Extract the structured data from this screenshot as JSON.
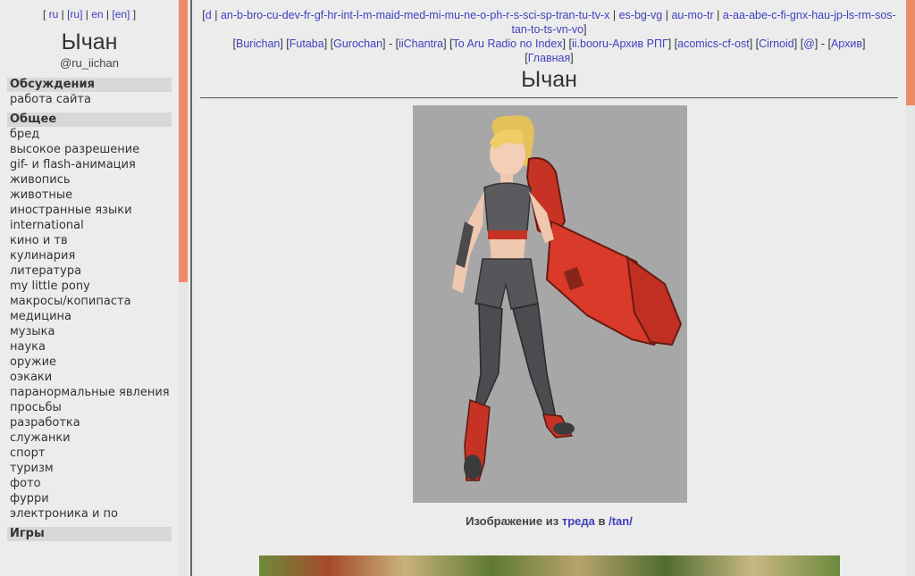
{
  "sidebar": {
    "lang_links": [
      {
        "label": "ru",
        "prefix": "[ ",
        "suffix": " | "
      },
      {
        "label": "[ru]",
        "prefix": "",
        "suffix": " | "
      },
      {
        "label": "en",
        "prefix": "",
        "suffix": " | "
      },
      {
        "label": "[en]",
        "prefix": "",
        "suffix": " ]"
      }
    ],
    "title": "Ычан",
    "handle": "@ru_iichan",
    "sections": [
      {
        "header": "Обсуждения",
        "items": [
          "работа сайта"
        ]
      },
      {
        "header": "Общее",
        "items": [
          "бред",
          "высокое разрешение",
          "gif- и flash-анимация",
          "живопись",
          "животные",
          "иностранные языки",
          "international",
          "кино и тв",
          "кулинария",
          "литература",
          "my little pony",
          "макросы/копипаста",
          "медицина",
          "музыка",
          "наука",
          "оружие",
          "оэкаки",
          "паранормальные явления",
          "просьбы",
          "разработка",
          "служанки",
          "спорт",
          "туризм",
          "фото",
          "фурри",
          "электроника и по"
        ]
      },
      {
        "header": "Игры",
        "items": []
      }
    ]
  },
  "nav": {
    "lines": [
      [
        {
          "t": "[",
          "link": false
        },
        {
          "t": "d",
          "link": true
        },
        {
          "t": " | ",
          "link": false
        },
        {
          "t": "an-b-bro-cu-dev-fr-gf-hr-int-l-m-maid-med-mi-mu-ne-o-ph-r-s-sci-sp-tran-tu-tv-x",
          "link": true
        },
        {
          "t": " | ",
          "link": false
        },
        {
          "t": "es-bg-vg",
          "link": true
        },
        {
          "t": " | ",
          "link": false
        },
        {
          "t": "au-mo-tr",
          "link": true
        },
        {
          "t": " | ",
          "link": false
        },
        {
          "t": "a-aa-abe-c-fi-gnx-hau-jp-ls-rm-sos-tan-to-ts-vn-vo",
          "link": true
        },
        {
          "t": "]",
          "link": false
        }
      ],
      [
        {
          "t": "[",
          "link": false
        },
        {
          "t": "Burichan",
          "link": true
        },
        {
          "t": "] [",
          "link": false
        },
        {
          "t": "Futaba",
          "link": true
        },
        {
          "t": "] [",
          "link": false
        },
        {
          "t": "Gurochan",
          "link": true
        },
        {
          "t": "] - [",
          "link": false
        },
        {
          "t": "iiChantra",
          "link": true
        },
        {
          "t": "] [",
          "link": false
        },
        {
          "t": "To Aru Radio no Index",
          "link": true
        },
        {
          "t": "] [",
          "link": false
        },
        {
          "t": "ii.booru-Архив РПГ",
          "link": true
        },
        {
          "t": "] [",
          "link": false
        },
        {
          "t": "acomics-cf-ost",
          "link": true
        },
        {
          "t": "] [",
          "link": false
        },
        {
          "t": "Cirnoid",
          "link": true
        },
        {
          "t": "] [",
          "link": false
        },
        {
          "t": "@",
          "link": true
        },
        {
          "t": "] - [",
          "link": false
        },
        {
          "t": "Архив",
          "link": true
        },
        {
          "t": "]",
          "link": false
        }
      ],
      [
        {
          "t": "[",
          "link": false
        },
        {
          "t": "Главная",
          "link": true
        },
        {
          "t": "]",
          "link": false
        }
      ]
    ]
  },
  "main": {
    "title": "Ычан",
    "caption": {
      "prefix": "Изображение из ",
      "thread_link": "треда",
      "middle": " в ",
      "board_link": "/tan/"
    }
  },
  "colors": {
    "accent": "#ec8b68",
    "link": "#3f3fbe",
    "background": "#ececec"
  }
}
